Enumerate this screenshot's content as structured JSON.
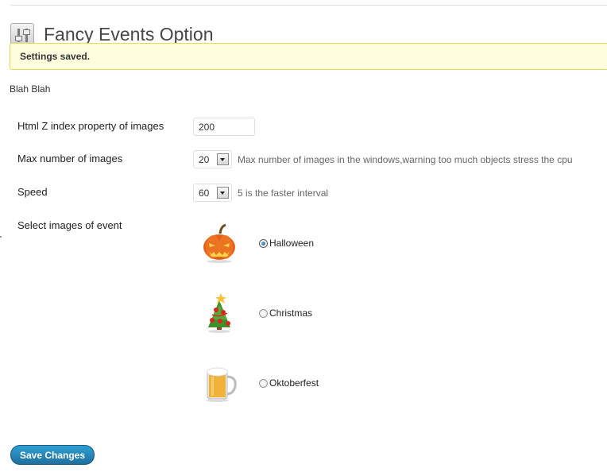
{
  "header": {
    "title": "Fancy Events Option",
    "icon": "settings-sliders-icon"
  },
  "notice": {
    "text": "Settings saved."
  },
  "intro": "Blah Blah",
  "fields": {
    "zindex": {
      "label": "Html Z index property of images",
      "value": "200"
    },
    "max_images": {
      "label": "Max number of images",
      "selected": "20",
      "hint": "Max number of images in the windows,warning too much objects stress the cpu"
    },
    "speed": {
      "label": "Speed",
      "selected": "60",
      "hint": "5 is the faster interval"
    },
    "events": {
      "label": "Select images of event",
      "options": [
        {
          "label": "Halloween",
          "icon": "pumpkin-icon",
          "checked": true
        },
        {
          "label": "Christmas",
          "icon": "christmas-tree-icon",
          "checked": false
        },
        {
          "label": "Oktoberfest",
          "icon": "beer-mug-icon",
          "checked": false
        }
      ]
    }
  },
  "save_button": {
    "label": "Save Changes"
  },
  "colors": {
    "accent": "#21759b",
    "notice_bg": "#ffffe0",
    "notice_border": "#e6db55"
  }
}
